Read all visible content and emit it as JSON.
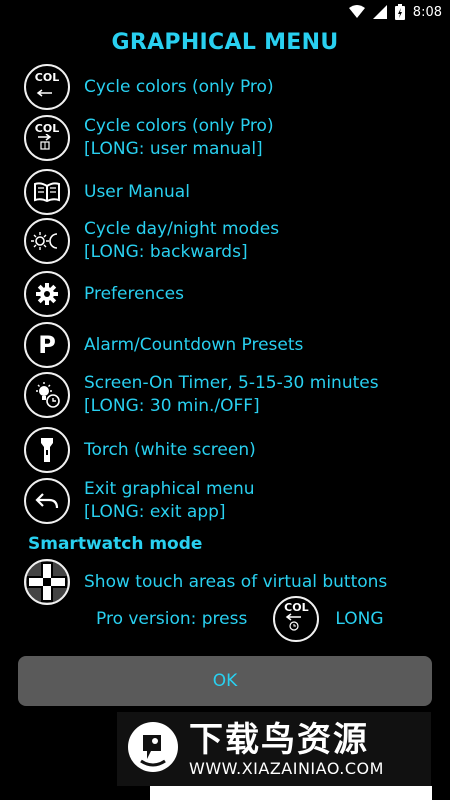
{
  "status_bar": {
    "time": "8:08"
  },
  "title": "GRAPHICAL MENU",
  "menu_items": [
    {
      "icon": "col-cycle-icon",
      "icon_text": "COL",
      "lines": [
        "Cycle colors (only Pro)"
      ]
    },
    {
      "icon": "col-manual-icon",
      "icon_text": "COL",
      "lines": [
        "Cycle colors (only Pro)",
        "[LONG: user manual]"
      ]
    },
    {
      "icon": "book-icon",
      "lines": [
        "User Manual"
      ]
    },
    {
      "icon": "day-night-icon",
      "lines": [
        "Cycle day/night modes",
        "[LONG: backwards]"
      ]
    },
    {
      "icon": "gear-icon",
      "lines": [
        "Preferences"
      ]
    },
    {
      "icon": "presets-icon",
      "icon_text": "P",
      "lines": [
        "Alarm/Countdown Presets"
      ]
    },
    {
      "icon": "screen-timer-icon",
      "lines": [
        "Screen-On Timer, 5-15-30 minutes",
        "[LONG: 30 min./OFF]"
      ]
    },
    {
      "icon": "torch-icon",
      "lines": [
        "Torch (white screen)"
      ]
    },
    {
      "icon": "back-arrow-icon",
      "lines": [
        "Exit graphical menu",
        "[LONG: exit app]"
      ]
    }
  ],
  "smartwatch": {
    "section_title": "Smartwatch mode",
    "touch_areas_label": "Show touch areas of virtual buttons",
    "pro_text": "Pro version: press",
    "pro_icon_text": "COL",
    "long_text": "LONG"
  },
  "ok_label": "OK",
  "watermark": {
    "cn_text": "下载鸟资源",
    "url": "WWW.XIAZAINIAO.COM"
  },
  "colors": {
    "accent": "#29d0f0",
    "background": "#000000",
    "button": "#5a5a5a"
  }
}
